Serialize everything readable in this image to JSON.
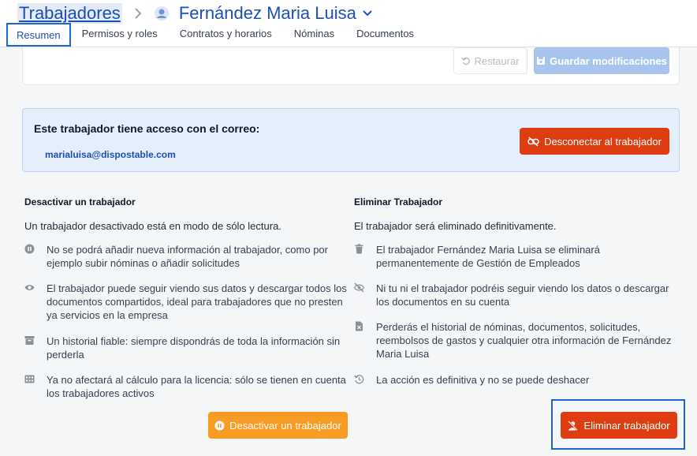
{
  "header": {
    "breadcrumb_parent": "Trabajadores",
    "title": "Fernández Maria Luisa"
  },
  "tabs": [
    {
      "label": "Resumen",
      "active": true
    },
    {
      "label": "Permisos y roles",
      "active": false
    },
    {
      "label": "Contratos y horarios",
      "active": false
    },
    {
      "label": "Nóminas",
      "active": false
    },
    {
      "label": "Documentos",
      "active": false
    }
  ],
  "form_actions": {
    "restore_label": "Restaurar",
    "save_label": "Guardar modificaciones"
  },
  "access": {
    "title": "Este trabajador tiene acceso con el correo:",
    "email": "marialuisa@dispostable.com",
    "disconnect_label": "Desconectar al trabajador"
  },
  "deactivate": {
    "title": "Desactivar un trabajador",
    "subtitle": "Un trabajador desactivado está en modo de sólo lectura.",
    "bullets": [
      {
        "icon": "pause-circle-icon",
        "text": "No se podrá añadir nueva información al trabajador, como por ejemplo subir nóminas o añadir solicitudes"
      },
      {
        "icon": "eye-icon",
        "text": "El trabajador puede seguir viendo sus datos y descargar todos los documentos compartidos, ideal para trabajadores que no presten ya servicios en la empresa"
      },
      {
        "icon": "archive-icon",
        "text": "Un historial fiable: siempre dispondrás de toda la información sin perderla"
      },
      {
        "icon": "calculator-icon",
        "text": "Ya no afectará al cálculo para la licencia: sólo se tienen en cuenta los trabajadores activos"
      }
    ],
    "button_label": "Desactivar un trabajador"
  },
  "delete": {
    "title": "Eliminar Trabajador",
    "subtitle": "El trabajador será eliminado definitivamente.",
    "bullets": [
      {
        "icon": "trash-icon",
        "text": "El trabajador Fernández Maria Luisa se eliminará permanentemente de Gestión de Empleados"
      },
      {
        "icon": "eye-slash-icon",
        "text": "Ni tu ni el trabajador podréis seguir viendo los datos o descargar los documentos en su cuenta"
      },
      {
        "icon": "file-x-icon",
        "text": "Perderás el historial de nóminas, documentos, solicitudes, reembolsos de gastos y cualquier otra información de Fernández Maria Luisa"
      },
      {
        "icon": "history-icon",
        "text": "La acción es definitiva y no se puede deshacer"
      }
    ],
    "button_label": "Eliminar trabajador"
  },
  "colors": {
    "primary_blue": "#1d4fb8",
    "danger_red": "#dd3d10",
    "warning_orange": "#f89b22",
    "info_bg": "#e5effb"
  }
}
